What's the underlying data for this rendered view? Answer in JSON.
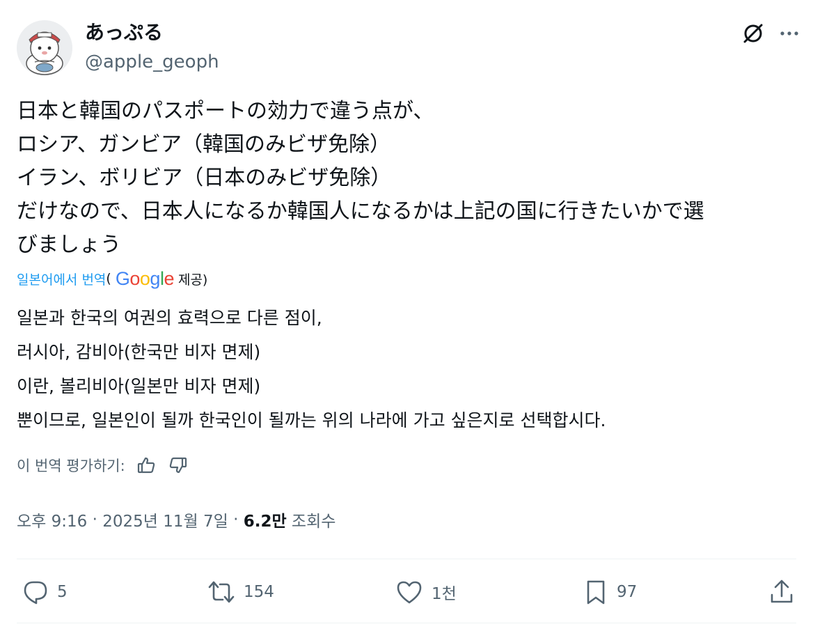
{
  "author": {
    "display_name": "あっぷる",
    "handle": "@apple_geoph"
  },
  "tweet": {
    "lines": [
      "日本と韓国のパスポートの効力で違う点が、",
      "ロシア、ガンビア（韓国のみビザ免除）",
      "イラン、ボリビア（日本のみビザ免除）",
      "だけなので、日本人になるか韓国人になるかは上記の国に行きたいかで選",
      "びましょう"
    ]
  },
  "translation_credit": {
    "link_label": "일본어에서 번역",
    "open_paren": "(",
    "provider": "Google",
    "suffix": "제공)"
  },
  "translation": {
    "lines": [
      "일본과 한국의 여권의 효력으로 다른 점이,",
      "러시아, 감비아(한국만 비자 면제)",
      "이란, 볼리비아(일본만 비자 면제)",
      "뿐이므로, 일본인이 될까 한국인이 될까는 위의 나라에 가고 싶은지로 선택합시다."
    ]
  },
  "rate": {
    "label": "이 번역 평가하기:"
  },
  "meta": {
    "time": "오후 9:16",
    "separator": " · ",
    "date": "2025년 11월 7일",
    "views_count": "6.2만",
    "views_label": " 조회수"
  },
  "actions": {
    "replies": "5",
    "reposts": "154",
    "likes": "1천",
    "bookmarks": "97"
  },
  "icons": {
    "header": [
      "grok-icon",
      "more-icon"
    ],
    "rate": [
      "thumbs-up-icon",
      "thumbs-down-icon"
    ],
    "actions": [
      "reply-icon",
      "retweet-icon",
      "heart-icon",
      "bookmark-icon",
      "share-icon"
    ]
  },
  "colors": {
    "text": "#0f1419",
    "secondary": "#536471",
    "link": "#1d9bf0",
    "divider": "#eff3f4",
    "google_blue": "#4285F4",
    "google_red": "#EA4335",
    "google_yellow": "#FBBC05",
    "google_green": "#34A853"
  }
}
